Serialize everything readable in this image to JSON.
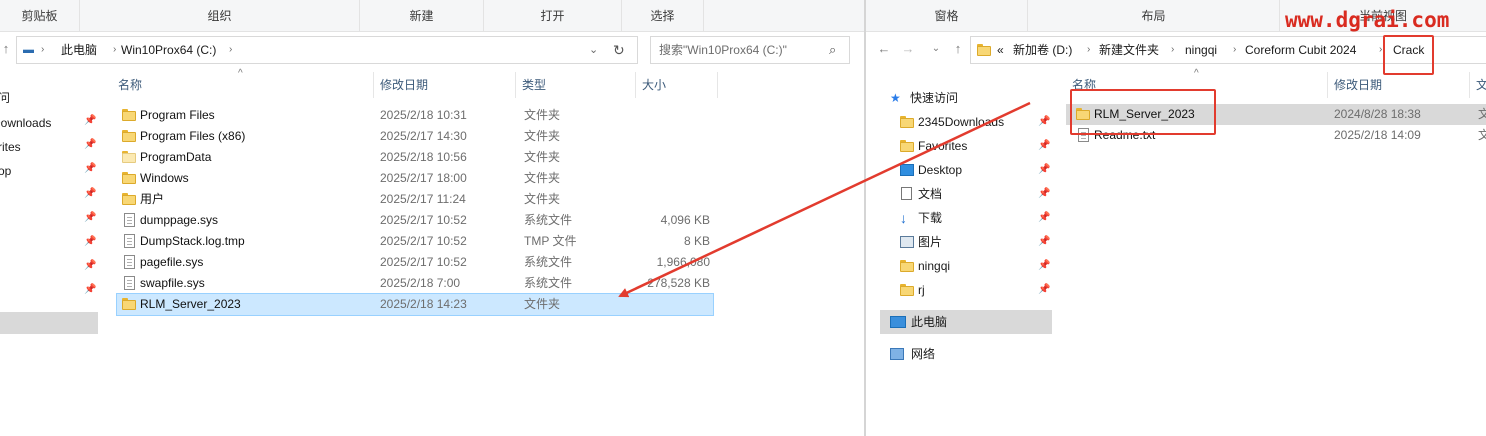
{
  "left": {
    "ribbon": {
      "clipboard": "剪贴板",
      "organize": "组织",
      "new": "新建",
      "open": "打开",
      "select": "选择"
    },
    "breadcrumb": [
      "此电脑",
      "Win10Prox64 (C:)"
    ],
    "search_placeholder": "搜索\"Win10Prox64 (C:)\"",
    "columns": {
      "name": "名称",
      "date": "修改日期",
      "type": "类型",
      "size": "大小"
    },
    "nav_items": [
      "问",
      "Downloads",
      "rites",
      "op"
    ],
    "files": [
      {
        "name": "Program Files",
        "date": "2025/2/18 10:31",
        "type": "文件夹",
        "size": "",
        "icon": "folder-icon"
      },
      {
        "name": "Program Files (x86)",
        "date": "2025/2/17 14:30",
        "type": "文件夹",
        "size": "",
        "icon": "folder-icon"
      },
      {
        "name": "ProgramData",
        "date": "2025/2/18 10:56",
        "type": "文件夹",
        "size": "",
        "icon": "folder-icon"
      },
      {
        "name": "Windows",
        "date": "2025/2/17 18:00",
        "type": "文件夹",
        "size": "",
        "icon": "folder-icon"
      },
      {
        "name": "用户",
        "date": "2025/2/17 11:24",
        "type": "文件夹",
        "size": "",
        "icon": "folder-icon"
      },
      {
        "name": "dumppage.sys",
        "date": "2025/2/17 10:52",
        "type": "系统文件",
        "size": "4,096 KB",
        "icon": "file-icon"
      },
      {
        "name": "DumpStack.log.tmp",
        "date": "2025/2/17 10:52",
        "type": "TMP 文件",
        "size": "8 KB",
        "icon": "file-icon"
      },
      {
        "name": "pagefile.sys",
        "date": "2025/2/17 10:52",
        "type": "系统文件",
        "size": "1,966,080",
        "icon": "file-icon"
      },
      {
        "name": "swapfile.sys",
        "date": "2025/2/18 7:00",
        "type": "系统文件",
        "size": "278,528 KB",
        "icon": "file-icon"
      },
      {
        "name": "RLM_Server_2023",
        "date": "2025/2/18 14:23",
        "type": "文件夹",
        "size": "",
        "icon": "folder-icon"
      }
    ]
  },
  "right": {
    "ribbon": {
      "pane": "窗格",
      "layout": "布局",
      "current_view": "当前视图"
    },
    "breadcrumb_prefix": "«",
    "breadcrumb": [
      "新加卷 (D:)",
      "新建文件夹",
      "ningqi",
      "Coreform Cubit 2024",
      "Crack"
    ],
    "columns": {
      "name": "名称",
      "date": "修改日期",
      "type": "文"
    },
    "nav": {
      "quick_access": "快速访问",
      "items": [
        "2345Downloads",
        "Favorites",
        "Desktop",
        "文档",
        "下载",
        "图片",
        "ningqi",
        "rj"
      ],
      "this_pc": "此电脑",
      "network": "网络"
    },
    "files": [
      {
        "name": "RLM_Server_2023",
        "date": "2024/8/28 18:38",
        "type": "文",
        "icon": "folder-icon"
      },
      {
        "name": "Readme.txt",
        "date": "2025/2/18 14:09",
        "type": "文",
        "icon": "file-icon"
      }
    ]
  },
  "watermark": "www.dgrai.com",
  "colors": {
    "annotation": "#e23b2e",
    "selection": "#cce8ff",
    "folder": "#f8d775"
  }
}
